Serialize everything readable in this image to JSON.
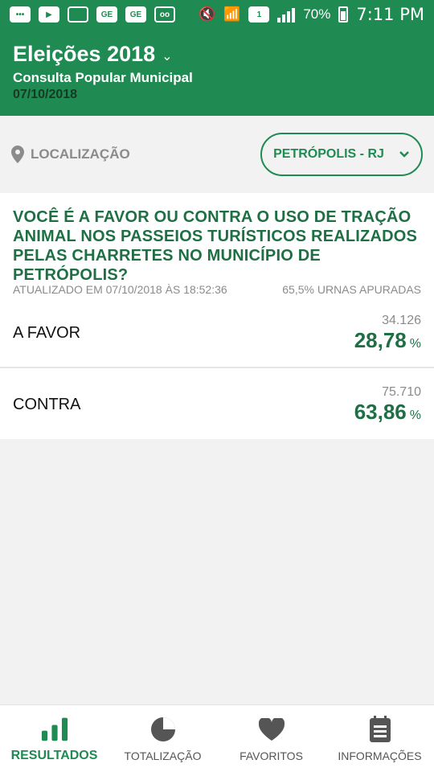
{
  "status_bar": {
    "battery": "70%",
    "time": "7:11 PM",
    "sim": "1"
  },
  "header": {
    "title": "Eleições 2018",
    "subtitle": "Consulta Popular Municipal",
    "date": "07/10/2018"
  },
  "location": {
    "label": "LOCALIZAÇÃO",
    "selected_city": "PETRÓPOLIS - RJ"
  },
  "question": {
    "text": "VOCÊ É A FAVOR OU CONTRA O USO DE TRAÇÃO ANIMAL NOS PASSEIOS TURÍSTICOS REALIZADOS PELAS CHARRETES NO MUNICÍPIO DE PETRÓPOLIS?",
    "updated": "ATUALIZADO EM 07/10/2018 ÀS 18:52:36",
    "counted": "65,5% URNAS APURADAS"
  },
  "results": [
    {
      "label": "A FAVOR",
      "votes": "34.126",
      "percent": "28,78",
      "unit": "%"
    },
    {
      "label": "CONTRA",
      "votes": "75.710",
      "percent": "63,86",
      "unit": "%"
    }
  ],
  "nav": {
    "items": [
      {
        "label": "RESULTADOS",
        "icon": "bar-chart-icon",
        "active": true
      },
      {
        "label": "TOTALIZAÇÃO",
        "icon": "pie-chart-icon",
        "active": false
      },
      {
        "label": "FAVORITOS",
        "icon": "heart-icon",
        "active": false
      },
      {
        "label": "INFORMAÇÕES",
        "icon": "document-icon",
        "active": false
      }
    ]
  },
  "colors": {
    "primary": "#1f8a52",
    "primary_dark": "#1f6f45",
    "muted": "#8b8b8b"
  }
}
